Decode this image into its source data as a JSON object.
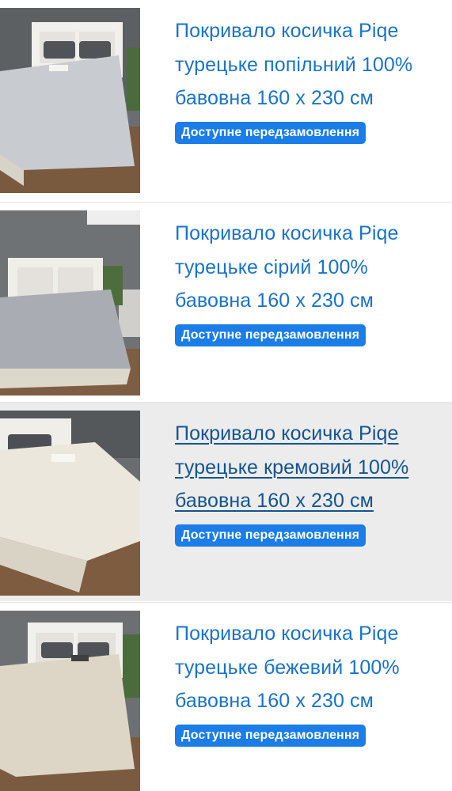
{
  "products": [
    {
      "title": "Покривало косичка Piqe турецьке попільний 100% бавовна 160 х 230 см",
      "badge": "Доступне передзамовлення",
      "image_icon": "bed-photo-icon",
      "blanket_color": "#c8cbd0",
      "hovered": false
    },
    {
      "title": "Покривало косичка Piqe турецьке сірий 100% бавовна 160 х 230 см",
      "badge": "Доступне передзамовлення",
      "image_icon": "bed-photo-icon",
      "blanket_color": "#a9adb3",
      "hovered": false
    },
    {
      "title": "Покривало косичка Piqe турецьке кремовий 100% бавовна 160 х 230 см",
      "badge": "Доступне передзамовлення",
      "image_icon": "bed-photo-icon",
      "blanket_color": "#ece7dc",
      "hovered": true
    },
    {
      "title": "Покривало косичка Piqe турецьке бежевий 100% бавовна 160 х 230 см",
      "badge": "Доступне передзамовлення",
      "image_icon": "bed-photo-icon",
      "blanket_color": "#ddd6c6",
      "hovered": false
    }
  ],
  "colors": {
    "link": "#1a73c8",
    "link_hover": "#14548f",
    "badge_bg": "#1a7de8",
    "hover_row_bg": "#ececec"
  }
}
